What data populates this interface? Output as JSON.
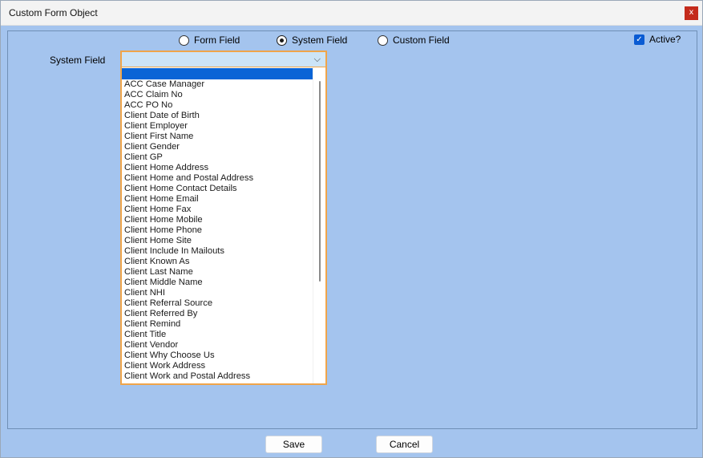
{
  "window": {
    "title": "Custom Form Object",
    "close_label": "x"
  },
  "source_type": {
    "options": [
      {
        "label": "Form Field",
        "checked": false
      },
      {
        "label": "System Field",
        "checked": true
      },
      {
        "label": "Custom Field",
        "checked": false
      }
    ]
  },
  "active": {
    "label": "Active?",
    "checked": true
  },
  "system_field": {
    "label": "System Field",
    "value": "",
    "options": [
      "ACC Case Manager",
      "ACC Claim No",
      "ACC PO No",
      "Client Date of Birth",
      "Client Employer",
      "Client First Name",
      "Client Gender",
      "Client GP",
      "Client Home Address",
      "Client Home and Postal Address",
      "Client Home Contact Details",
      "Client Home Email",
      "Client Home Fax",
      "Client Home Mobile",
      "Client Home Phone",
      "Client Home Site",
      "Client Include In Mailouts",
      "Client Known As",
      "Client Last Name",
      "Client Middle Name",
      "Client NHI",
      "Client Referral Source",
      "Client Referred By",
      "Client Remind",
      "Client Title",
      "Client Vendor",
      "Client Why Choose Us",
      "Client Work Address",
      "Client Work and Postal Address"
    ]
  },
  "buttons": {
    "save": "Save",
    "cancel": "Cancel"
  },
  "colors": {
    "accent": "#0a64d6",
    "focus_border": "#f0a54a",
    "panel": "#a4c4ee",
    "close": "#c42b1c"
  }
}
